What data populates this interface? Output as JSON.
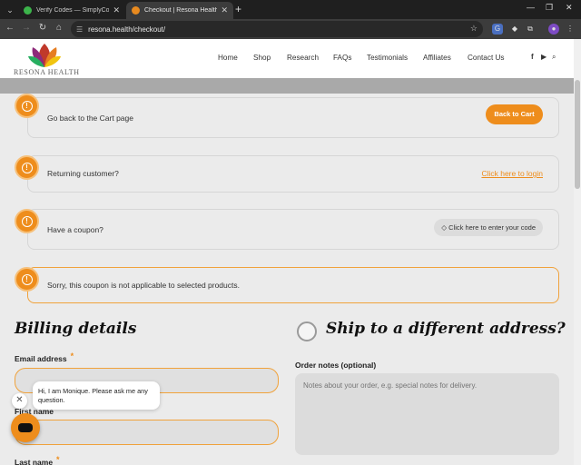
{
  "browser": {
    "tabs": [
      {
        "title": "Verify Codes — SimplyCodes",
        "favicon_color": "#3cb44b"
      },
      {
        "title": "Checkout | Resona Health - Re",
        "favicon_color": "#e88a1f"
      }
    ],
    "url": "resona.health/checkout/",
    "icons": [
      "tab-search-icon",
      "back-icon",
      "forward-icon",
      "reload-icon",
      "home-icon",
      "site-info-icon",
      "star-icon",
      "extensions-icon",
      "profile-icon",
      "menu-icon"
    ]
  },
  "site": {
    "brand": "RESONA HEALTH",
    "nav": [
      "Home",
      "Shop",
      "Research",
      "FAQs",
      "Testimonials",
      "Affiliates",
      "Contact Us"
    ],
    "social_icons": [
      "facebook-icon",
      "youtube-icon",
      "search-icon"
    ],
    "accent": "#ee8d1c"
  },
  "notices": {
    "cart": {
      "text": "Go back to the Cart page",
      "button": "Back to Cart"
    },
    "returning": {
      "text": "Returning customer?",
      "link": "Click here to login"
    },
    "coupon": {
      "text": "Have a coupon?",
      "button": "Click here to enter your code"
    },
    "error": {
      "text": "Sorry, this coupon is not applicable to selected products."
    }
  },
  "billing": {
    "title": "Billing details",
    "email_label": "Email address",
    "first_name_label": "First name",
    "last_name_label": "Last name",
    "required_mark": "*"
  },
  "shipping": {
    "title": "Ship to a different address?",
    "order_notes_label": "Order notes (optional)",
    "order_notes_placeholder": "Notes about your order, e.g. special notes for delivery."
  },
  "chat": {
    "message": "Hi, I am Monique. Please ask me any question."
  }
}
